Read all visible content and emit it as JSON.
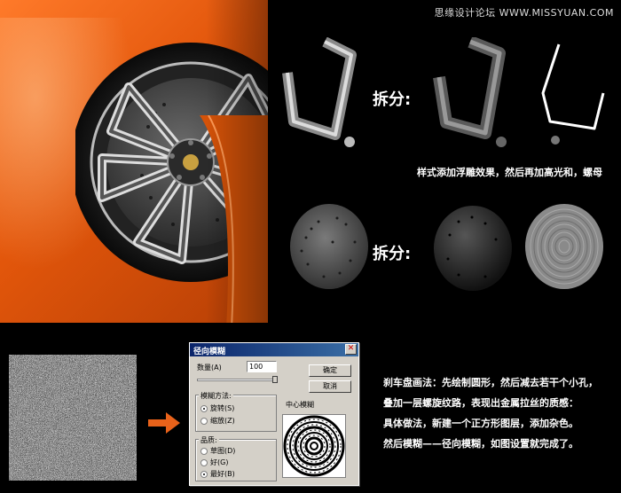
{
  "watermark": "思缘设计论坛 WWW.MISSYUAN.COM",
  "split_label_1": "拆分:",
  "split_label_2": "拆分:",
  "description_1": "样式添加浮雕效果，然后再加高光和，螺母",
  "dialog": {
    "title": "径向模糊",
    "close": "✕",
    "amount_label": "数量(A)",
    "amount_value": "100",
    "ok_button": "确定",
    "cancel_button": "取消",
    "method_label": "模糊方法:",
    "method_options": [
      "旋转(S)",
      "缩放(Z)"
    ],
    "method_selected": 0,
    "quality_label": "品质:",
    "quality_options": [
      "草图(D)",
      "好(G)",
      "最好(B)"
    ],
    "quality_selected": 2,
    "center_label": "中心模糊"
  },
  "steps": [
    "刹车盘画法：先绘制圆形，然后减去若干个小孔，",
    "叠加一层螺旋纹路，表现出金属拉丝的质感：",
    "具体做法，新建一个正方形图层，添加杂色。",
    "然后模糊——径向模糊，如图设置就完成了。"
  ],
  "colors": {
    "background": "#000000",
    "car_orange": "#e2560b",
    "arrow_orange": "#e8621a",
    "dialog_title": "#0a246a"
  }
}
